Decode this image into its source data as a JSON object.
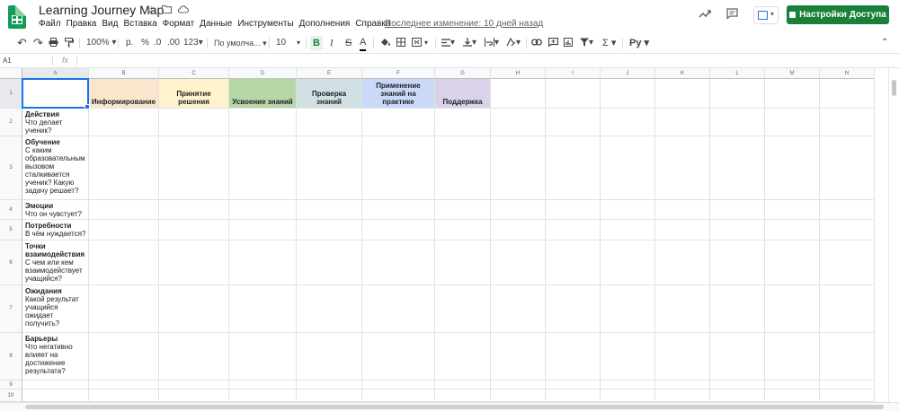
{
  "app": {
    "title": "Learning Journey Map",
    "menu": [
      "Файл",
      "Правка",
      "Вид",
      "Вставка",
      "Формат",
      "Данные",
      "Инструменты",
      "Дополнения",
      "Справка"
    ],
    "last_edit": "Последнее изменение: 10 дней назад",
    "share_label": "Настройки Доступа"
  },
  "toolbar": {
    "zoom": "100%",
    "currency": "р.",
    "percent": "%",
    "dec_decrease": ".0",
    "dec_increase": ".00",
    "format_more": "123",
    "font": "По умолча...",
    "font_size": "10",
    "bold": "B",
    "italic": "I",
    "strike": "S",
    "text_color": "A"
  },
  "formula_bar": {
    "name_box": "A1",
    "fx": "fx",
    "value": ""
  },
  "grid": {
    "columns": [
      "A",
      "B",
      "C",
      "D",
      "E",
      "F",
      "G",
      "H",
      "I",
      "J",
      "K",
      "L",
      "M",
      "N"
    ],
    "selected_cell": "A1",
    "stages": [
      {
        "col": "B",
        "label": "Информирование",
        "color": "#fce5cd"
      },
      {
        "col": "C",
        "label": "Принятие решения",
        "color": "#fff2cc"
      },
      {
        "col": "D",
        "label": "Усвоение знаний",
        "color": "#b6d7a8"
      },
      {
        "col": "E",
        "label": "Проверка знаний",
        "color": "#d0e0e3"
      },
      {
        "col": "F",
        "label": "Применение знаний на практике",
        "color": "#c9daf8"
      },
      {
        "col": "G",
        "label": "Поддержка",
        "color": "#d9d2e9"
      }
    ],
    "rows": [
      {
        "num": "1"
      },
      {
        "num": "2",
        "title": "Действия",
        "lines": [
          "Что делает",
          "ученик?"
        ]
      },
      {
        "num": "3",
        "title": "Обучение",
        "lines": [
          "С каким",
          "образовательным",
          "вызовом",
          "сталкивается",
          "ученик? Какую",
          "задачу решает?"
        ]
      },
      {
        "num": "4",
        "title": "Эмоции",
        "lines": [
          "Что он чувстует?"
        ]
      },
      {
        "num": "5",
        "title": "Потребности",
        "lines": [
          "В чём нуждается?"
        ]
      },
      {
        "num": "6",
        "title_lines": [
          "Точки",
          "взаимодействия"
        ],
        "lines": [
          "С чем или кем",
          "взаимодействует",
          "учащийся?"
        ]
      },
      {
        "num": "7",
        "title": "Ожидания",
        "lines": [
          "Какой результат",
          "учащийся",
          "ожидает",
          "получить?"
        ]
      },
      {
        "num": "8",
        "title": "Барьеры",
        "lines": [
          "Что негативно",
          "влияет на",
          "достижение",
          "результата?"
        ]
      },
      {
        "num": "9"
      },
      {
        "num": "10"
      }
    ]
  }
}
